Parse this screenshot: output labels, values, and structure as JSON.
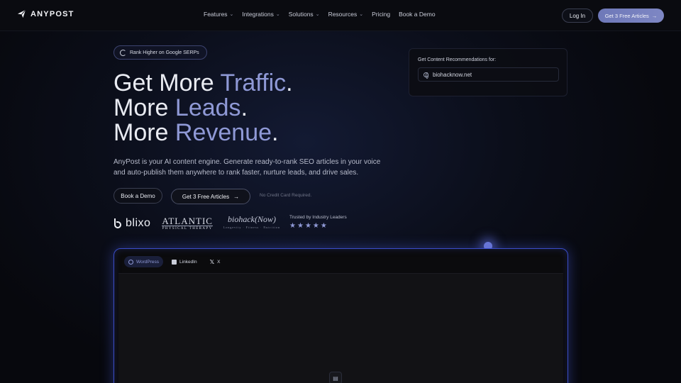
{
  "brand": {
    "name": "ANYPOST"
  },
  "nav": {
    "items": [
      {
        "label": "Features",
        "dropdown": true
      },
      {
        "label": "Integrations",
        "dropdown": true
      },
      {
        "label": "Solutions",
        "dropdown": true
      },
      {
        "label": "Resources",
        "dropdown": true
      },
      {
        "label": "Pricing",
        "dropdown": false
      },
      {
        "label": "Book a Demo",
        "dropdown": false
      }
    ],
    "login_label": "Log In",
    "cta_label": "Get 3 Free Articles",
    "cta_arrow": "→"
  },
  "hero": {
    "badge": "Rank Higher on Google SERPs",
    "lines": [
      {
        "pre": "Get More ",
        "hl": "Traffic",
        "post": "."
      },
      {
        "pre": "More ",
        "hl": "Leads",
        "post": "."
      },
      {
        "pre": "More ",
        "hl": "Revenue",
        "post": "."
      }
    ],
    "subtitle": "AnyPost is your AI content engine. Generate ready-to-rank SEO articles in your voice and auto-publish them anywhere to rank faster, nurture leads, and drive sales.",
    "demo_label": "Book a Demo",
    "free_label": "Get 3 Free Articles",
    "free_arrow": "→",
    "no_cc": "No Credit Card Required."
  },
  "logos": {
    "blixo": "blixo",
    "atlantic_top": "ATLANTIC",
    "atlantic_bottom": "PHYSICAL THERAPY",
    "biohack": "biohack(Now)",
    "biohack_sub": "Longevity · Fitness · Nutrition",
    "trusted": "Trusted by Industry Leaders",
    "stars": [
      "★",
      "★",
      "★",
      "★",
      "★"
    ],
    "rating_stars": 5
  },
  "reco": {
    "label": "Get Content Recommendations for:",
    "value": "biohacknow.net"
  },
  "preview": {
    "tabs": [
      {
        "label": "WordPress",
        "active": true
      },
      {
        "label": "LinkedIn",
        "active": false
      },
      {
        "label": "X",
        "active": false
      }
    ]
  },
  "colors": {
    "accent": "#8f99d6",
    "cta": "#7e87c4",
    "preview_border": "#3a4cc8"
  }
}
